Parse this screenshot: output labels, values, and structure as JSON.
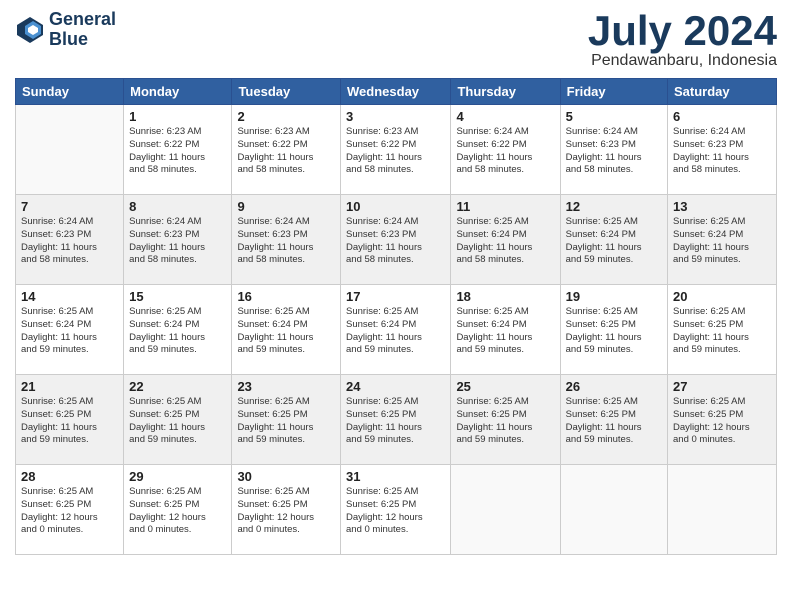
{
  "header": {
    "logo_line1": "General",
    "logo_line2": "Blue",
    "month": "July 2024",
    "location": "Pendawanbaru, Indonesia"
  },
  "days_of_week": [
    "Sunday",
    "Monday",
    "Tuesday",
    "Wednesday",
    "Thursday",
    "Friday",
    "Saturday"
  ],
  "weeks": [
    [
      {
        "day": "",
        "info": ""
      },
      {
        "day": "1",
        "info": "Sunrise: 6:23 AM\nSunset: 6:22 PM\nDaylight: 11 hours\nand 58 minutes."
      },
      {
        "day": "2",
        "info": "Sunrise: 6:23 AM\nSunset: 6:22 PM\nDaylight: 11 hours\nand 58 minutes."
      },
      {
        "day": "3",
        "info": "Sunrise: 6:23 AM\nSunset: 6:22 PM\nDaylight: 11 hours\nand 58 minutes."
      },
      {
        "day": "4",
        "info": "Sunrise: 6:24 AM\nSunset: 6:22 PM\nDaylight: 11 hours\nand 58 minutes."
      },
      {
        "day": "5",
        "info": "Sunrise: 6:24 AM\nSunset: 6:23 PM\nDaylight: 11 hours\nand 58 minutes."
      },
      {
        "day": "6",
        "info": "Sunrise: 6:24 AM\nSunset: 6:23 PM\nDaylight: 11 hours\nand 58 minutes."
      }
    ],
    [
      {
        "day": "7",
        "info": "Sunrise: 6:24 AM\nSunset: 6:23 PM\nDaylight: 11 hours\nand 58 minutes."
      },
      {
        "day": "8",
        "info": "Sunrise: 6:24 AM\nSunset: 6:23 PM\nDaylight: 11 hours\nand 58 minutes."
      },
      {
        "day": "9",
        "info": "Sunrise: 6:24 AM\nSunset: 6:23 PM\nDaylight: 11 hours\nand 58 minutes."
      },
      {
        "day": "10",
        "info": "Sunrise: 6:24 AM\nSunset: 6:23 PM\nDaylight: 11 hours\nand 58 minutes."
      },
      {
        "day": "11",
        "info": "Sunrise: 6:25 AM\nSunset: 6:24 PM\nDaylight: 11 hours\nand 58 minutes."
      },
      {
        "day": "12",
        "info": "Sunrise: 6:25 AM\nSunset: 6:24 PM\nDaylight: 11 hours\nand 59 minutes."
      },
      {
        "day": "13",
        "info": "Sunrise: 6:25 AM\nSunset: 6:24 PM\nDaylight: 11 hours\nand 59 minutes."
      }
    ],
    [
      {
        "day": "14",
        "info": "Sunrise: 6:25 AM\nSunset: 6:24 PM\nDaylight: 11 hours\nand 59 minutes."
      },
      {
        "day": "15",
        "info": "Sunrise: 6:25 AM\nSunset: 6:24 PM\nDaylight: 11 hours\nand 59 minutes."
      },
      {
        "day": "16",
        "info": "Sunrise: 6:25 AM\nSunset: 6:24 PM\nDaylight: 11 hours\nand 59 minutes."
      },
      {
        "day": "17",
        "info": "Sunrise: 6:25 AM\nSunset: 6:24 PM\nDaylight: 11 hours\nand 59 minutes."
      },
      {
        "day": "18",
        "info": "Sunrise: 6:25 AM\nSunset: 6:24 PM\nDaylight: 11 hours\nand 59 minutes."
      },
      {
        "day": "19",
        "info": "Sunrise: 6:25 AM\nSunset: 6:25 PM\nDaylight: 11 hours\nand 59 minutes."
      },
      {
        "day": "20",
        "info": "Sunrise: 6:25 AM\nSunset: 6:25 PM\nDaylight: 11 hours\nand 59 minutes."
      }
    ],
    [
      {
        "day": "21",
        "info": "Sunrise: 6:25 AM\nSunset: 6:25 PM\nDaylight: 11 hours\nand 59 minutes."
      },
      {
        "day": "22",
        "info": "Sunrise: 6:25 AM\nSunset: 6:25 PM\nDaylight: 11 hours\nand 59 minutes."
      },
      {
        "day": "23",
        "info": "Sunrise: 6:25 AM\nSunset: 6:25 PM\nDaylight: 11 hours\nand 59 minutes."
      },
      {
        "day": "24",
        "info": "Sunrise: 6:25 AM\nSunset: 6:25 PM\nDaylight: 11 hours\nand 59 minutes."
      },
      {
        "day": "25",
        "info": "Sunrise: 6:25 AM\nSunset: 6:25 PM\nDaylight: 11 hours\nand 59 minutes."
      },
      {
        "day": "26",
        "info": "Sunrise: 6:25 AM\nSunset: 6:25 PM\nDaylight: 11 hours\nand 59 minutes."
      },
      {
        "day": "27",
        "info": "Sunrise: 6:25 AM\nSunset: 6:25 PM\nDaylight: 12 hours\nand 0 minutes."
      }
    ],
    [
      {
        "day": "28",
        "info": "Sunrise: 6:25 AM\nSunset: 6:25 PM\nDaylight: 12 hours\nand 0 minutes."
      },
      {
        "day": "29",
        "info": "Sunrise: 6:25 AM\nSunset: 6:25 PM\nDaylight: 12 hours\nand 0 minutes."
      },
      {
        "day": "30",
        "info": "Sunrise: 6:25 AM\nSunset: 6:25 PM\nDaylight: 12 hours\nand 0 minutes."
      },
      {
        "day": "31",
        "info": "Sunrise: 6:25 AM\nSunset: 6:25 PM\nDaylight: 12 hours\nand 0 minutes."
      },
      {
        "day": "",
        "info": ""
      },
      {
        "day": "",
        "info": ""
      },
      {
        "day": "",
        "info": ""
      }
    ]
  ]
}
